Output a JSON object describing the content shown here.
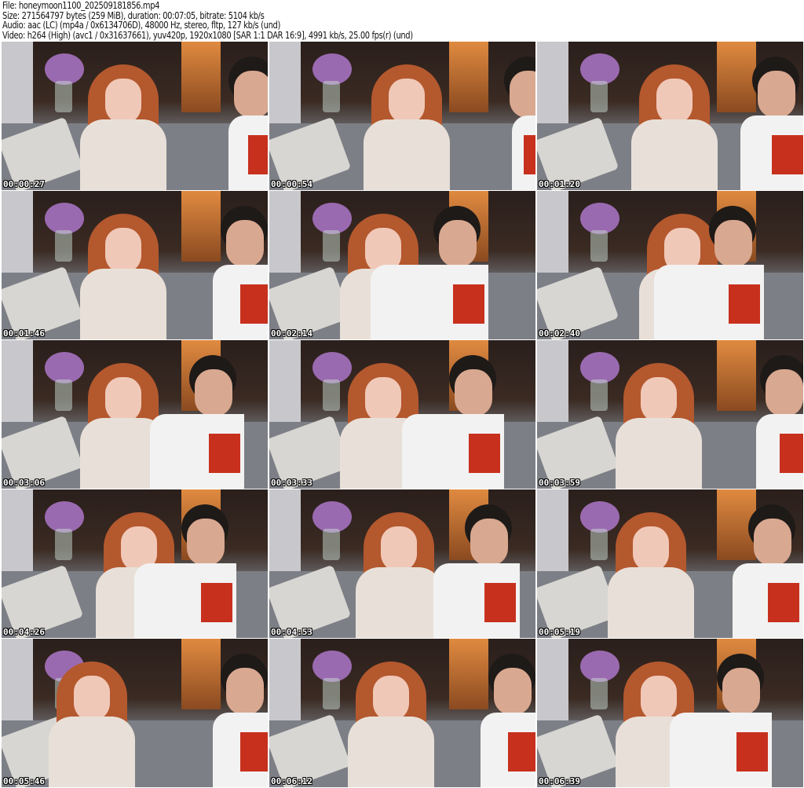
{
  "header": {
    "file": "File: honeymoon1100_202509181856.mp4",
    "size": "Size: 271564797 bytes (259 MiB), duration: 00:07:05, bitrate: 5104 kb/s",
    "audio": "Audio: aac (LC) (mp4a / 0x6134706D), 48000 Hz, stereo, fltp, 127 kb/s (und)",
    "video": "Video: h264 (High) (avc1 / 0x31637661), yuv420p, 1920x1080 [SAR 1:1 DAR 16:9], 4991 kb/s, 25.00 fps(r) (und)"
  },
  "thumbnails": [
    {
      "timestamp": "00:00:27"
    },
    {
      "timestamp": "00:00:54"
    },
    {
      "timestamp": "00:01:20"
    },
    {
      "timestamp": "00:01:46"
    },
    {
      "timestamp": "00:02:14"
    },
    {
      "timestamp": "00:02:40"
    },
    {
      "timestamp": "00:03:06"
    },
    {
      "timestamp": "00:03:33"
    },
    {
      "timestamp": "00:03:59"
    },
    {
      "timestamp": "00:04:26"
    },
    {
      "timestamp": "00:04:53"
    },
    {
      "timestamp": "00:05:19"
    },
    {
      "timestamp": "00:05:46"
    },
    {
      "timestamp": "00:06:12"
    },
    {
      "timestamp": "00:06:39"
    }
  ]
}
